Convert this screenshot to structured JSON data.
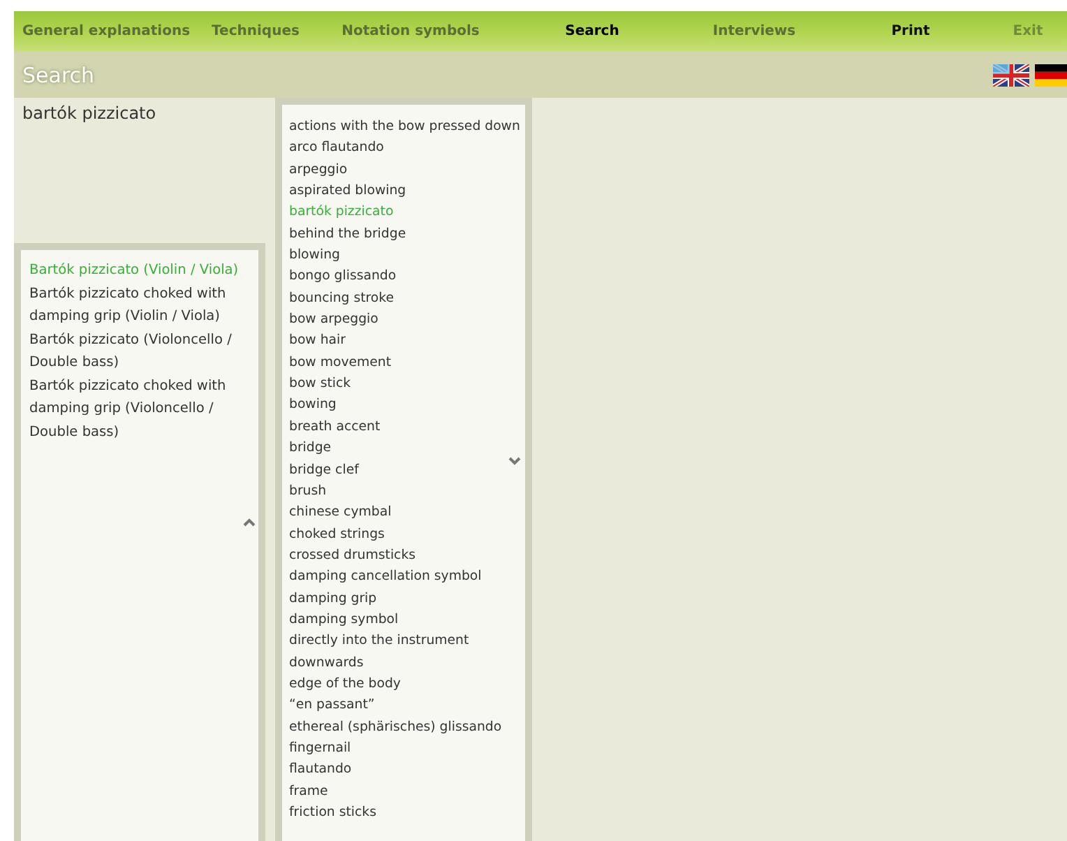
{
  "nav": [
    {
      "label": "General explanations",
      "kind": "link"
    },
    {
      "label": "Techniques",
      "kind": "link"
    },
    {
      "label": "Notation symbols",
      "kind": "link"
    },
    {
      "label": "Search",
      "kind": "current"
    },
    {
      "label": "Interviews",
      "kind": "link"
    },
    {
      "label": "Print",
      "kind": "action"
    },
    {
      "label": "Exit",
      "kind": "exit"
    }
  ],
  "header": {
    "title": "Search"
  },
  "query": "bartók pizzicato",
  "results": [
    {
      "label": "Bartók pizzicato (Violin / Viola)",
      "selected": true
    },
    {
      "label": "Bartók pizzicato choked with damping grip (Violin / Viola)",
      "selected": false
    },
    {
      "label": "Bartók pizzicato (Violoncello / Double bass)",
      "selected": false
    },
    {
      "label": "Bartók pizzicato choked with damping grip (Violoncello / Double bass)",
      "selected": false
    }
  ],
  "index": [
    {
      "label": "actions with the bow pressed down",
      "selected": false
    },
    {
      "label": "arco flautando",
      "selected": false
    },
    {
      "label": "arpeggio",
      "selected": false
    },
    {
      "label": "aspirated blowing",
      "selected": false
    },
    {
      "label": "bartók pizzicato",
      "selected": true
    },
    {
      "label": "behind the bridge",
      "selected": false
    },
    {
      "label": "blowing",
      "selected": false
    },
    {
      "label": "bongo glissando",
      "selected": false
    },
    {
      "label": "bouncing stroke",
      "selected": false
    },
    {
      "label": "bow arpeggio",
      "selected": false
    },
    {
      "label": "bow hair",
      "selected": false
    },
    {
      "label": "bow movement",
      "selected": false
    },
    {
      "label": "bow stick",
      "selected": false
    },
    {
      "label": "bowing",
      "selected": false
    },
    {
      "label": "breath accent",
      "selected": false
    },
    {
      "label": "bridge",
      "selected": false
    },
    {
      "label": "bridge clef",
      "selected": false
    },
    {
      "label": "brush",
      "selected": false
    },
    {
      "label": "chinese cymbal",
      "selected": false
    },
    {
      "label": "choked strings",
      "selected": false
    },
    {
      "label": "crossed drumsticks",
      "selected": false
    },
    {
      "label": "damping cancellation symbol",
      "selected": false
    },
    {
      "label": "damping grip",
      "selected": false
    },
    {
      "label": "damping symbol",
      "selected": false
    },
    {
      "label": "directly into the instrument",
      "selected": false
    },
    {
      "label": "downwards",
      "selected": false
    },
    {
      "label": "edge of the body",
      "selected": false
    },
    {
      "label": "“en passant”",
      "selected": false
    },
    {
      "label": "ethereal (sphärisches) glissando",
      "selected": false
    },
    {
      "label": "fingernail",
      "selected": false
    },
    {
      "label": "flautando",
      "selected": false
    },
    {
      "label": "frame",
      "selected": false
    },
    {
      "label": "friction sticks",
      "selected": false
    }
  ]
}
